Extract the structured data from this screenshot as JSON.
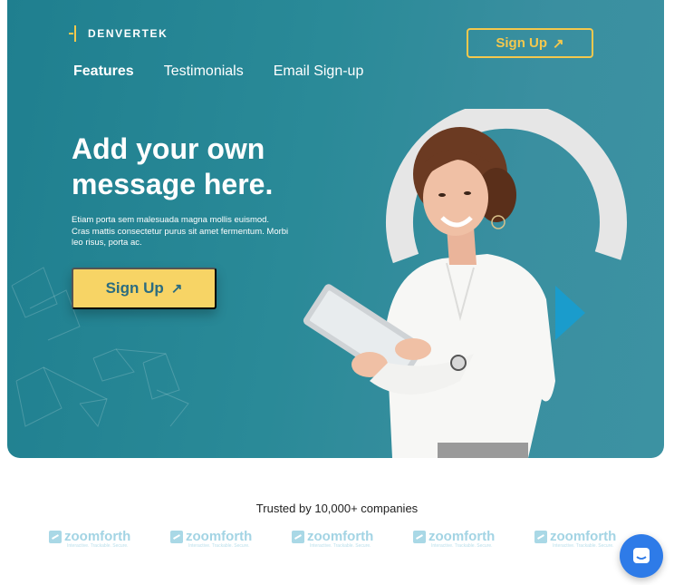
{
  "header": {
    "logo_text": "DENVERTEK",
    "signup_label": "Sign Up",
    "signup_arrow": "↗"
  },
  "nav": {
    "items": [
      {
        "label": "Features",
        "active": true
      },
      {
        "label": "Testimonials",
        "active": false
      },
      {
        "label": "Email Sign-up",
        "active": false
      }
    ]
  },
  "hero": {
    "headline": "Add your own message here.",
    "body": "Etiam porta sem malesuada magna mollis euismod. Cras mattis consectetur purus sit amet fermentum. Morbi leo risus, porta ac.",
    "cta_label": "Sign Up",
    "cta_arrow": "↗"
  },
  "trusted": {
    "heading": "Trusted by 10,000+ companies",
    "logos": [
      {
        "name": "zoomforth",
        "tagline": "Interactive. Trackable. Secure."
      },
      {
        "name": "zoomforth",
        "tagline": "Interactive. Trackable. Secure."
      },
      {
        "name": "zoomforth",
        "tagline": "Interactive. Trackable. Secure."
      },
      {
        "name": "zoomforth",
        "tagline": "Interactive. Trackable. Secure."
      },
      {
        "name": "zoomforth",
        "tagline": "Interactive. Trackable. Secure."
      }
    ]
  },
  "icons": {
    "logo": "brand-mark-icon",
    "chat": "chat-bubble-icon",
    "arrow": "arrow-up-right-icon"
  },
  "colors": {
    "hero_bg": "#2a8a98",
    "accent_yellow": "#f7d465",
    "chat_blue": "#2e7be8",
    "logo_light_blue": "#a3d4e4"
  }
}
